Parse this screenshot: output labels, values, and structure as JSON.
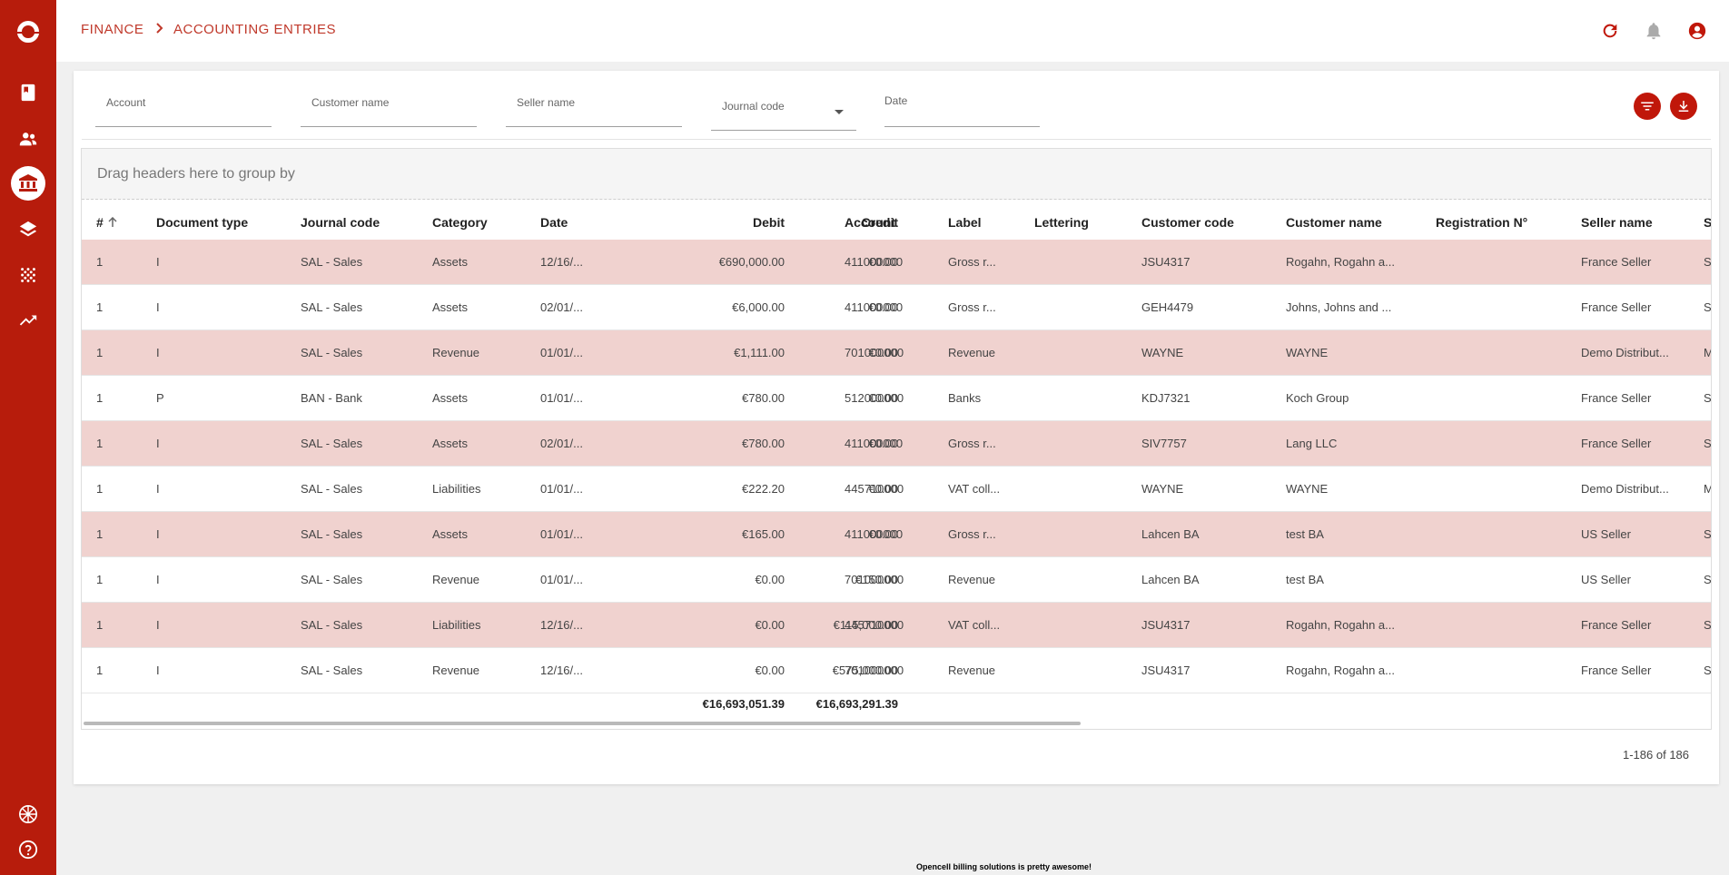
{
  "app": {
    "footer": "Opencell billing solutions is pretty awesome!"
  },
  "colors": {
    "brand": "#b71c0c",
    "accent": "#c0170a",
    "row_shade": "#f0d2cf",
    "text": "#333333"
  },
  "sidebar": {
    "items": [
      {
        "name": "book-icon",
        "active": false
      },
      {
        "name": "users-icon",
        "active": false
      },
      {
        "name": "bank-icon",
        "active": true
      },
      {
        "name": "layers-icon",
        "active": false
      },
      {
        "name": "dots-grid-icon",
        "active": false
      },
      {
        "name": "trending-up-icon",
        "active": false
      },
      {
        "name": "flag-uk-icon",
        "active": false
      },
      {
        "name": "help-icon",
        "active": false
      }
    ]
  },
  "breadcrumb": {
    "parent": "FINANCE",
    "current": "ACCOUNTING ENTRIES"
  },
  "filters": {
    "account": "Account",
    "customer_name": "Customer name",
    "seller_name": "Seller name",
    "journal_code": "Journal code",
    "date": "Date"
  },
  "grid": {
    "group_hint": "Drag headers here to group by",
    "columns": [
      "#",
      "Document type",
      "Journal code",
      "Category",
      "Date",
      "Debit",
      "Credit",
      "Account",
      "Label",
      "Lettering",
      "Customer code",
      "Customer name",
      "Registration N°",
      "Seller name",
      "S"
    ],
    "sort_indicator": "arrow-up-icon",
    "rows": [
      {
        "num": "1",
        "doc": "I",
        "journal": "SAL - Sales",
        "category": "Assets",
        "date": "12/16/...",
        "debit": "€690,000.00",
        "credit": "€0.00",
        "account": "411000000",
        "label": "Gross r...",
        "lettering": "",
        "cust_code": "JSU4317",
        "cust_name": "Rogahn, Rogahn a...",
        "reg": "",
        "seller": "France Seller",
        "extra": "S"
      },
      {
        "num": "1",
        "doc": "I",
        "journal": "SAL - Sales",
        "category": "Assets",
        "date": "02/01/...",
        "debit": "€6,000.00",
        "credit": "€0.00",
        "account": "411000000",
        "label": "Gross r...",
        "lettering": "",
        "cust_code": "GEH4479",
        "cust_name": "Johns, Johns and ...",
        "reg": "",
        "seller": "France Seller",
        "extra": "S"
      },
      {
        "num": "1",
        "doc": "I",
        "journal": "SAL - Sales",
        "category": "Revenue",
        "date": "01/01/...",
        "debit": "€1,111.00",
        "credit": "€0.00",
        "account": "701000000",
        "label": "Revenue",
        "lettering": "",
        "cust_code": "WAYNE",
        "cust_name": "WAYNE",
        "reg": "",
        "seller": "Demo Distribut...",
        "extra": "M"
      },
      {
        "num": "1",
        "doc": "P",
        "journal": "BAN - Bank",
        "category": "Assets",
        "date": "01/01/...",
        "debit": "€780.00",
        "credit": "€0.00",
        "account": "512000000",
        "label": "Banks",
        "lettering": "",
        "cust_code": "KDJ7321",
        "cust_name": "Koch Group",
        "reg": "",
        "seller": "France Seller",
        "extra": "S"
      },
      {
        "num": "1",
        "doc": "I",
        "journal": "SAL - Sales",
        "category": "Assets",
        "date": "02/01/...",
        "debit": "€780.00",
        "credit": "€0.00",
        "account": "411000000",
        "label": "Gross r...",
        "lettering": "",
        "cust_code": "SIV7757",
        "cust_name": "Lang LLC",
        "reg": "",
        "seller": "France Seller",
        "extra": "S"
      },
      {
        "num": "1",
        "doc": "I",
        "journal": "SAL - Sales",
        "category": "Liabilities",
        "date": "01/01/...",
        "debit": "€222.20",
        "credit": "€0.00",
        "account": "445710000",
        "label": "VAT coll...",
        "lettering": "",
        "cust_code": "WAYNE",
        "cust_name": "WAYNE",
        "reg": "",
        "seller": "Demo Distribut...",
        "extra": "M"
      },
      {
        "num": "1",
        "doc": "I",
        "journal": "SAL - Sales",
        "category": "Assets",
        "date": "01/01/...",
        "debit": "€165.00",
        "credit": "€0.00",
        "account": "411000000",
        "label": "Gross r...",
        "lettering": "",
        "cust_code": "Lahcen BA",
        "cust_name": "test BA",
        "reg": "",
        "seller": "US Seller",
        "extra": "S"
      },
      {
        "num": "1",
        "doc": "I",
        "journal": "SAL - Sales",
        "category": "Revenue",
        "date": "01/01/...",
        "debit": "€0.00",
        "credit": "€150.00",
        "account": "701000000",
        "label": "Revenue",
        "lettering": "",
        "cust_code": "Lahcen BA",
        "cust_name": "test BA",
        "reg": "",
        "seller": "US Seller",
        "extra": "S"
      },
      {
        "num": "1",
        "doc": "I",
        "journal": "SAL - Sales",
        "category": "Liabilities",
        "date": "12/16/...",
        "debit": "€0.00",
        "credit": "€115,000.00",
        "account": "445710000",
        "label": "VAT coll...",
        "lettering": "",
        "cust_code": "JSU4317",
        "cust_name": "Rogahn, Rogahn a...",
        "reg": "",
        "seller": "France Seller",
        "extra": "S"
      },
      {
        "num": "1",
        "doc": "I",
        "journal": "SAL - Sales",
        "category": "Revenue",
        "date": "12/16/...",
        "debit": "€0.00",
        "credit": "€575,000.00",
        "account": "701000000",
        "label": "Revenue",
        "lettering": "",
        "cust_code": "JSU4317",
        "cust_name": "Rogahn, Rogahn a...",
        "reg": "",
        "seller": "France Seller",
        "extra": "S"
      }
    ],
    "totals": {
      "debit": "€16,693,051.39",
      "credit": "€16,693,291.39"
    }
  },
  "pagination": {
    "range": "1-186 of 186"
  }
}
